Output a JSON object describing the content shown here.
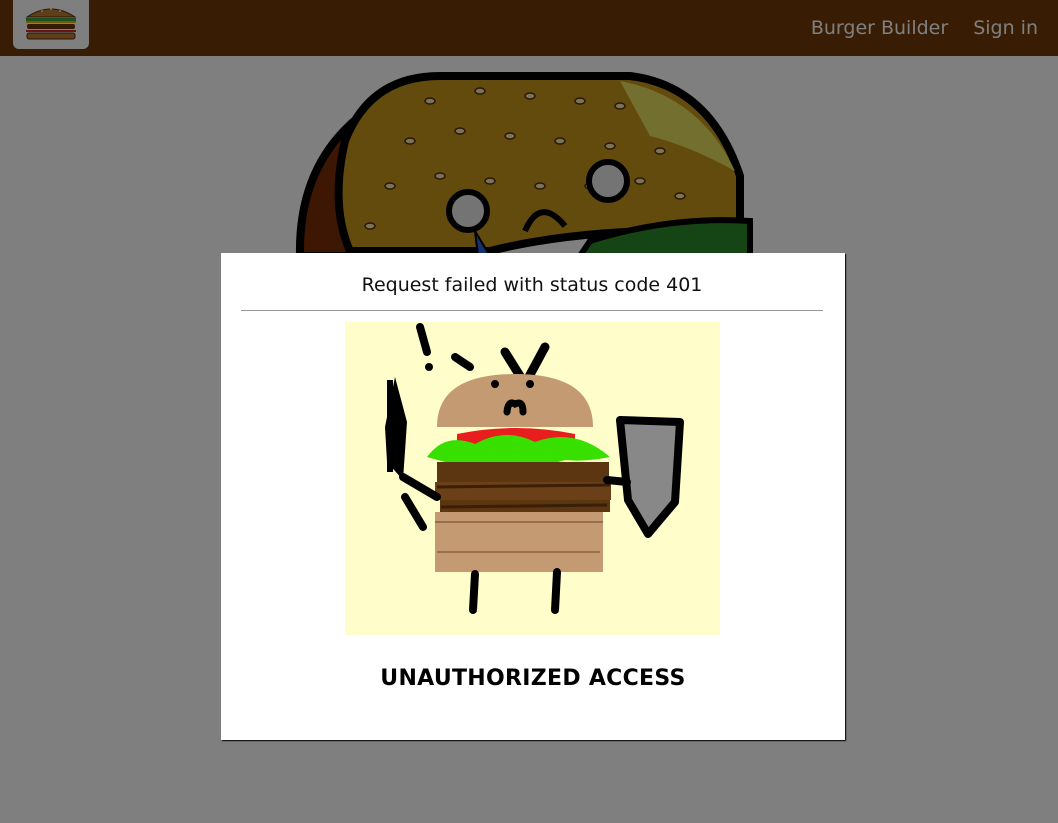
{
  "toolbar": {
    "logo_icon": "burger-logo-icon",
    "nav": [
      {
        "label": "Burger Builder"
      },
      {
        "label": "Sign in"
      }
    ]
  },
  "modal": {
    "title": "Request failed with status code 401",
    "illustration_icon": "angry-burger-knight-illustration",
    "message": "UNAUTHORIZED ACCESS"
  },
  "colors": {
    "toolbar_bg": "#703B09",
    "backdrop": "rgba(0,0,0,0.5)",
    "modal_bg": "#FFFFFF",
    "illustration_bg": "#FFFDC9"
  }
}
